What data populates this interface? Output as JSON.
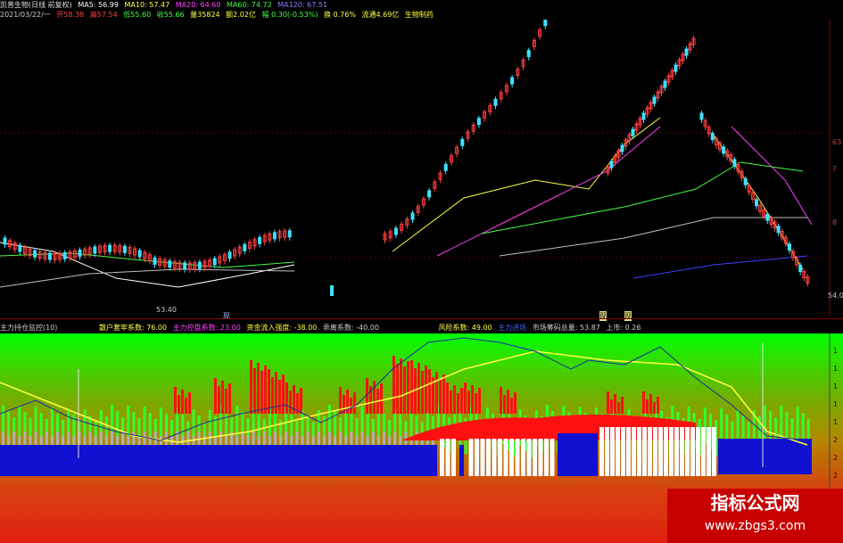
{
  "header": {
    "title": "凯普生物(日线 前复权)",
    "ma5": "MA5: 56.99",
    "ma10": "MA10: 57.47",
    "ma20": "MA20: 64.60",
    "ma60": "MA60: 74.72",
    "ma120": "MA120: 67.51",
    "date": "2021/03/22/一",
    "open": "开58.38",
    "high": "高57.54",
    "low": "低55.60",
    "close": "收55.66",
    "volume": "量35824",
    "amount": "额2.02亿",
    "change": "幅 0.30(-0.53%)",
    "turnover": "换 0.76%",
    "float": "流通4.69亿",
    "sector": "生物制药"
  },
  "price_axis": {
    "labels": [
      "63",
      "7",
      "8",
      "54.0"
    ],
    "low_marker": "53.40"
  },
  "markers": {
    "m1": "现",
    "m2": "现",
    "m3": "现"
  },
  "indicator_header": {
    "name": "主力持仓监控(10)",
    "f1": "散户套牢系数: 76.00",
    "f2": "主力控盘系数: 23.00",
    "f3": "资金流入强度: -38.00",
    "f4": "乖离系数: -40.00",
    "f5": "风险系数: 49.00",
    "f6": "主力进场",
    "f7": "市场筹码总量: 53.87",
    "f8": "上市: 0.26"
  },
  "indicator_axis": {
    "labels": [
      "1",
      "1",
      "1",
      "1",
      "1",
      "2",
      "2",
      "2"
    ]
  },
  "watermark": {
    "line1": "指标公式网",
    "line2": "www.zbgs3.com"
  },
  "colors": {
    "up": "#ff4040",
    "down": "#40e0ff",
    "ma5": "#ffffff",
    "ma10": "#ffff40",
    "ma20": "#ff40ff",
    "ma60": "#40ff40",
    "ma120": "#4040ff"
  }
}
